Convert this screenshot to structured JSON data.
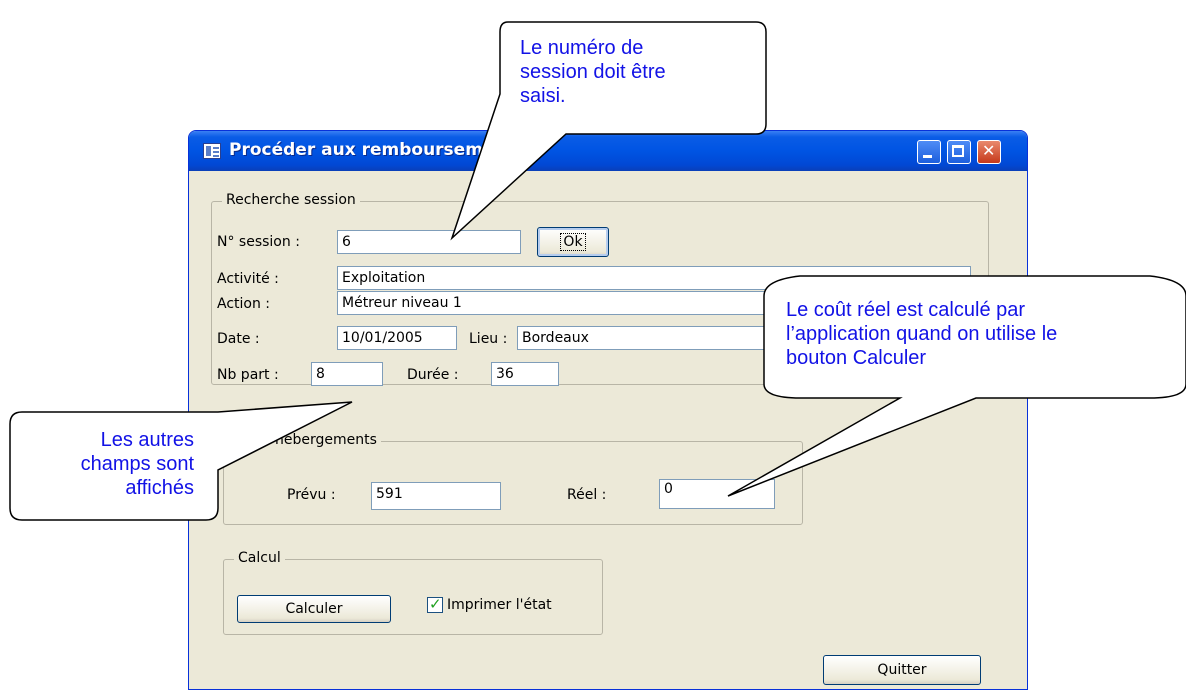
{
  "window": {
    "title": "Procéder aux remboursements",
    "icon": "form-icon"
  },
  "recherche": {
    "legend": "Recherche session",
    "session_label": "N° session :",
    "session_value": "6",
    "ok_label": "Ok"
  },
  "infos": {
    "activite_label": "Activité :",
    "activite_value": "Exploitation",
    "action_label": "Action :",
    "action_value": "Métreur niveau 1",
    "date_label": "Date :",
    "date_value": "10/01/2005",
    "lieu_label": "Lieu :",
    "lieu_value": "Bordeaux",
    "nbpart_label": "Nb part :",
    "nbpart_value": "8",
    "duree_label": "Durée :",
    "duree_value": "36"
  },
  "frais": {
    "legend": "Frais hébergements",
    "prevu_label": "Prévu :",
    "prevu_value": "591",
    "reel_label": "Réel :",
    "reel_value": "0"
  },
  "calcul": {
    "legend": "Calcul",
    "calculer_label": "Calculer",
    "imprimer_label": "Imprimer l'état",
    "imprimer_checked": true
  },
  "quitter_label": "Quitter",
  "callouts": {
    "session_line1": "Le numéro de",
    "session_line2": "session doit être",
    "session_line3": "saisi.",
    "cout_line1": "Le coût réel est calculé par",
    "cout_line2": "l’application quand on utilise le",
    "cout_line3": "bouton Calculer",
    "autres_line1": "Les autres",
    "autres_line2": "champs sont",
    "autres_line3": "affichés",
    "color": "#1212e6"
  }
}
